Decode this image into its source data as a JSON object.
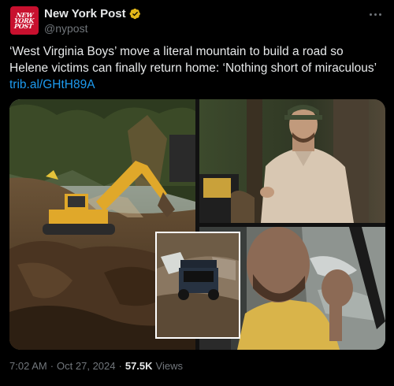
{
  "post": {
    "author_name": "New York Post",
    "author_handle": "@nypost",
    "avatar_logo_text": "NEW YORK POST",
    "text": "‘West Virginia Boys’ move a literal mountain to build a road so Helene victims can finally return home: ‘Nothing short of miraculous’",
    "link": "trib.al/GHtH89A",
    "time": "7:02 AM",
    "separator": "·",
    "date": "Oct 27, 2024",
    "views_count": "57.5K",
    "views_label": "Views"
  },
  "icons": {
    "verified": "verified-badge-icon",
    "more": "more-options-icon"
  },
  "colors": {
    "background": "#000000",
    "text": "#e7e9ea",
    "secondary": "#71767b",
    "link": "#1d9bf0",
    "brand": "#c8102e",
    "verified_badge": "#e2b719"
  }
}
